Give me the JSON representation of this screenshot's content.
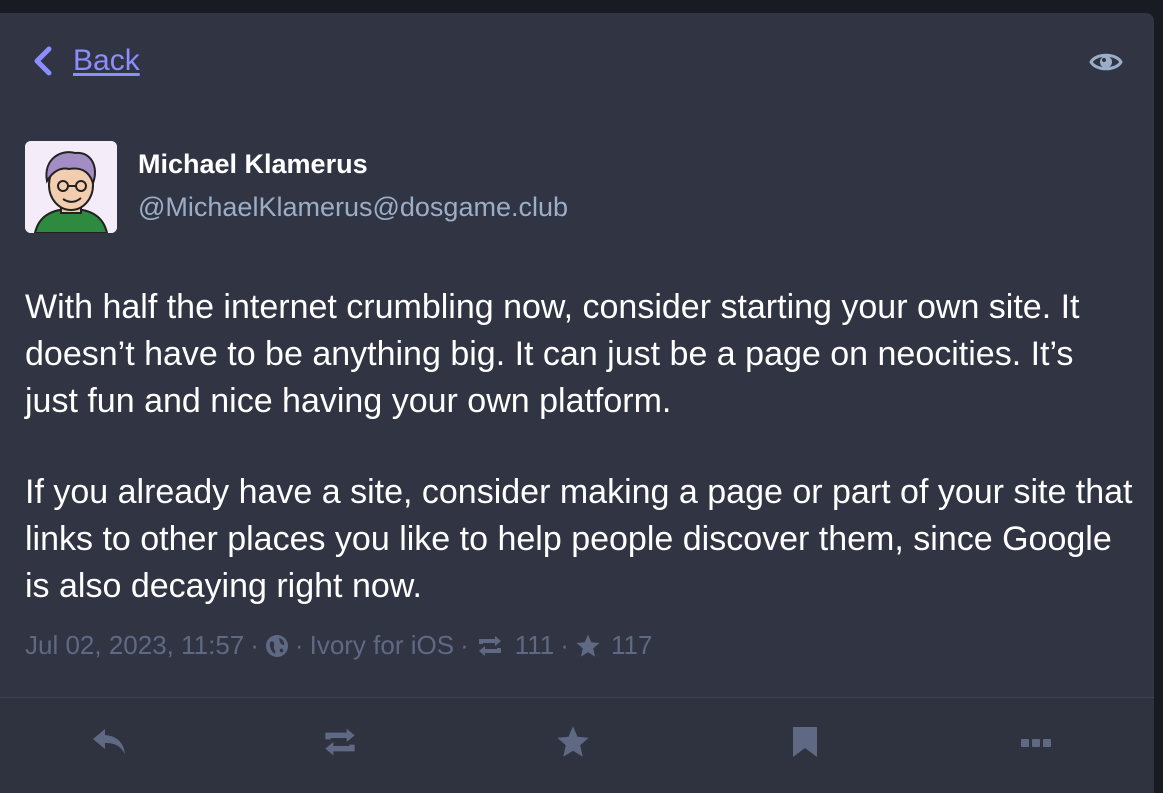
{
  "nav": {
    "back_label": "Back"
  },
  "status": {
    "author": {
      "display_name": "Michael Klamerus",
      "acct": "@MichaelKlamerus@dosgame.club"
    },
    "paragraphs": [
      "With half the internet crumbling now, consider starting your own site. It doesn’t have to be anything big. It can just be a page on neocities. It’s just fun and nice having your own platform.",
      "If you already have a site, consider making a page or part of your site that links to other places you like to help people discover them, since Google is also decaying right now."
    ],
    "meta": {
      "timestamp": "Jul 02, 2023, 11:57",
      "application": "Ivory for iOS",
      "boosts": "111",
      "favourites": "117",
      "separator": "·"
    }
  },
  "icons": {
    "back": "chevron-left-icon",
    "visibility": "eye-icon",
    "privacy": "globe-icon",
    "boost": "retweet-icon",
    "favourite": "star-icon",
    "reply": "reply-icon",
    "bookmark": "bookmark-icon",
    "more": "ellipsis-icon"
  },
  "colors": {
    "background": "#313543",
    "accent": "#8c8dff",
    "text_primary": "#ffffff",
    "text_secondary": "#9baec8",
    "text_muted": "#606984"
  }
}
